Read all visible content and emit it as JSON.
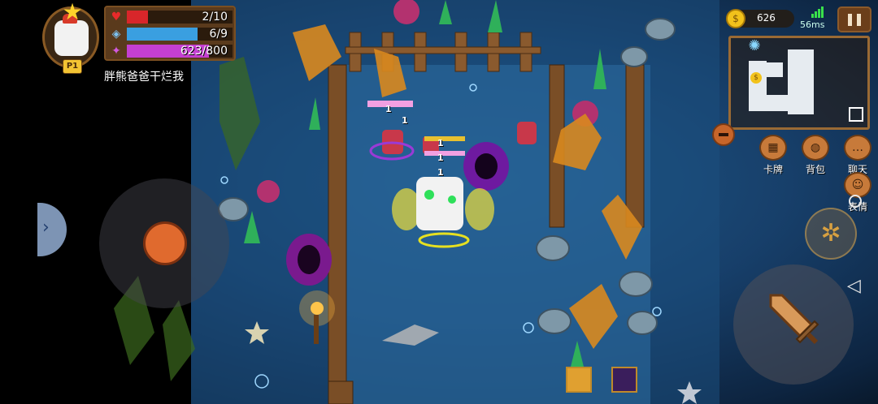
{
  "player": {
    "badge": "P1",
    "name": "胖熊爸爸干烂我",
    "hp": {
      "current": 2,
      "max": 10,
      "text": "2/10"
    },
    "armor": {
      "current": 6,
      "max": 9,
      "text": "6/9"
    },
    "energy": {
      "current": 623,
      "max": 800,
      "text": "623/800"
    }
  },
  "top_right": {
    "coins": "626",
    "ping": "56ms"
  },
  "menu": {
    "cards_label": "卡牌",
    "backpack_label": "背包",
    "chat_label": "聊天",
    "emote_label": "表情"
  },
  "combat": {
    "damage_numbers": [
      "1",
      "1",
      "1",
      "1",
      "1"
    ]
  },
  "colors": {
    "hp": "#d8262a",
    "armor": "#3a9fe0",
    "energy": "#c53fd2",
    "hud_frame": "#7a4f22",
    "accent_orange": "#e06a2e"
  },
  "icons": {
    "hp": "heart-icon",
    "armor": "shield-icon",
    "energy": "energy-icon",
    "coin": "coin-icon",
    "attack": "sword-icon",
    "skill": "skill-icon"
  }
}
